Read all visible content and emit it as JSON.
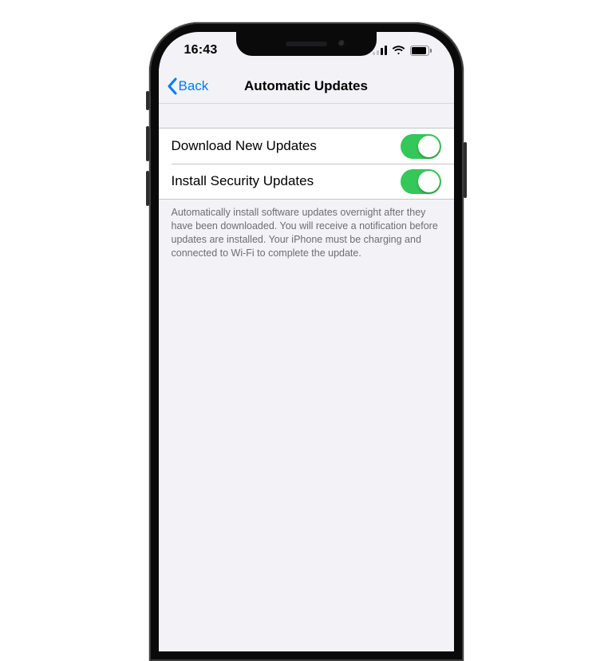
{
  "statusbar": {
    "time": "16:43"
  },
  "nav": {
    "back_label": "Back",
    "title": "Automatic Updates"
  },
  "rows": {
    "download_label": "Download New Updates",
    "install_label": "Install Security Updates",
    "download_on": true,
    "install_on": true
  },
  "footer": "Automatically install software updates overnight after they have been downloaded. You will receive a notification before updates are installed. Your iPhone must be charging and connected to Wi-Fi to complete the update.",
  "colors": {
    "link": "#007aff",
    "toggle_on": "#34c759",
    "bg": "#f2f2f7",
    "separator": "#c6c6c8",
    "footer_text": "#6d6d72"
  }
}
